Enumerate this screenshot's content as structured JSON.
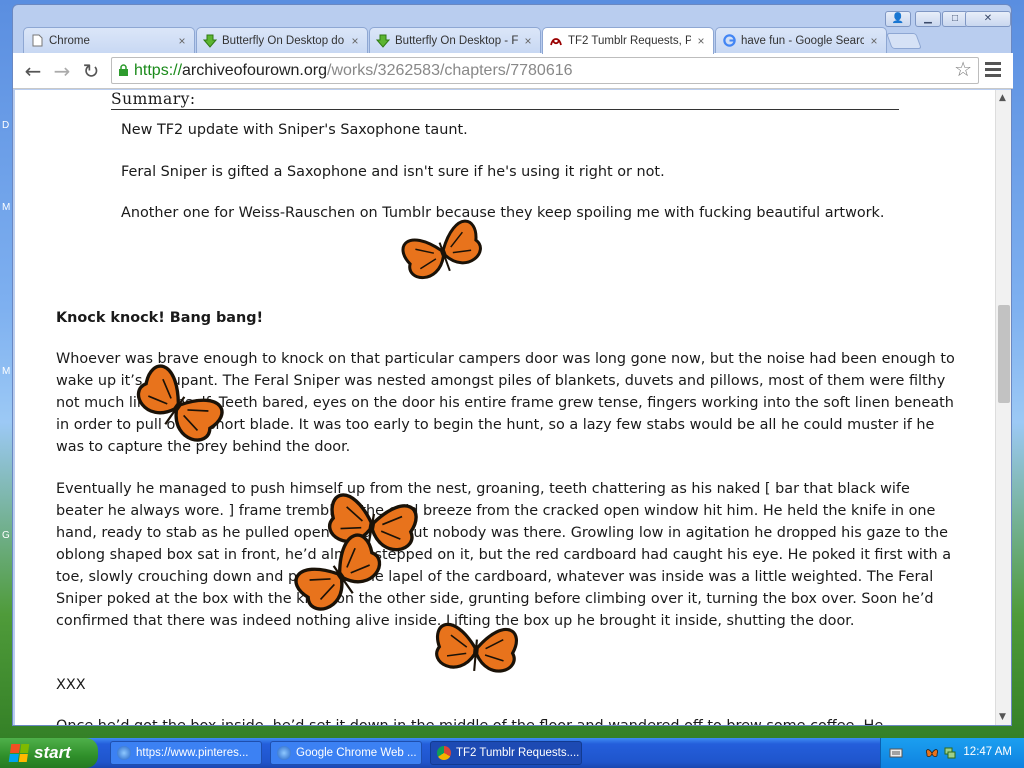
{
  "desktop": {
    "edge_letters": [
      "D",
      "M",
      "M",
      "G"
    ]
  },
  "browser": {
    "tabs": [
      {
        "title": "Chrome",
        "icon": "page-icon",
        "active": false
      },
      {
        "title": "Butterfly On Desktop do",
        "icon": "download-icon",
        "active": false
      },
      {
        "title": "Butterfly On Desktop - F",
        "icon": "download-icon",
        "active": false
      },
      {
        "title": "TF2 Tumblr Requests, P",
        "icon": "ao3-icon",
        "active": true
      },
      {
        "title": "have fun - Google Searc",
        "icon": "google-icon",
        "active": false
      }
    ],
    "tab_close_glyph": "×",
    "window_buttons": {
      "user": "👤",
      "minimize": "▁",
      "maximize": "□",
      "close": "✕"
    },
    "nav": {
      "back": "←",
      "forward": "→",
      "reload": "↻"
    },
    "url": {
      "scheme": "https://",
      "host": "archiveofourown.org",
      "path": "/works/3262583/chapters/7780616"
    },
    "star_glyph": "☆"
  },
  "page": {
    "summary_heading": "Summary:",
    "summary": [
      "New TF2 update with Sniper's Saxophone taunt.",
      "Feral Sniper is gifted a Saxophone and isn't sure if he's using it right or not.",
      "Another one for Weiss-Rauschen on Tumblr because they keep spoiling me with fucking beautiful artwork."
    ],
    "chapter_title": "Knock knock! Bang bang!",
    "paragraphs": [
      "Whoever was brave enough to knock on that particular campers door was long gone now, but the noise had been enough to wake up it’s occupant. The Feral Sniper was nested amongst piles of blankets, duvets and pillows, most of them were filthy not much like himself. Teeth bared, eyes on the door his entire frame grew tense, fingers working into the soft linen beneath in order to pull out a short blade. It was too early to begin the hunt, so a lazy few stabs would be all he could muster if he was to capture the prey behind the door.",
      "Eventually he managed to push himself up from the nest, groaning, teeth chattering as his naked [ bar that black wife beater he always wore. ] frame trembled, the cold breeze from the cracked open window hit him. He held the knife in one hand, ready to stab as he pulled open the door, but nobody was there. Growling low in agitation he dropped his gaze to the oblong shaped box sat in front, he’d almost stepped on it, but the red cardboard had caught his eye. He poked it first with a toe, slowly crouching down and pulling at the lapel of the cardboard, whatever was inside was a little weighted. The Feral Sniper poked at the box with the knife on the other side, grunting before climbing over it, turning the box over. Soon he’d confirmed that there was indeed nothing alive inside. Lifting the box up he brought it inside, shutting the door.",
      "XXX",
      "Once he’d got the box inside, he’d set it down in the middle of the floor and wandered off to brew some coffee. He"
    ]
  },
  "taskbar": {
    "start_label": "start",
    "tasks": [
      {
        "label": "https://www.pinteres...",
        "icon": "ie-icon",
        "active": false
      },
      {
        "label": "Google Chrome Web ...",
        "icon": "ie-icon",
        "active": false
      },
      {
        "label": "TF2 Tumblr Requests....",
        "icon": "chrome-icon",
        "active": true
      }
    ],
    "clock": "12:47 AM"
  },
  "colors": {
    "butterfly_orange": "#e8731c",
    "butterfly_black": "#1a1208",
    "taskbar_blue": "#245edb"
  }
}
